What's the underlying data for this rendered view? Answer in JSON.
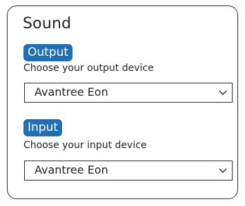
{
  "sound": {
    "title": "Sound",
    "output": {
      "badge": "Output",
      "hint": "Choose your output device",
      "selected": "Avantree Eon"
    },
    "input": {
      "badge": "Input",
      "hint": "Choose your input device",
      "selected": "Avantree Eon"
    }
  },
  "colors": {
    "accent": "#1f6fb2",
    "border": "#2b2b2b"
  },
  "icons": [
    "chevron-down-icon"
  ]
}
